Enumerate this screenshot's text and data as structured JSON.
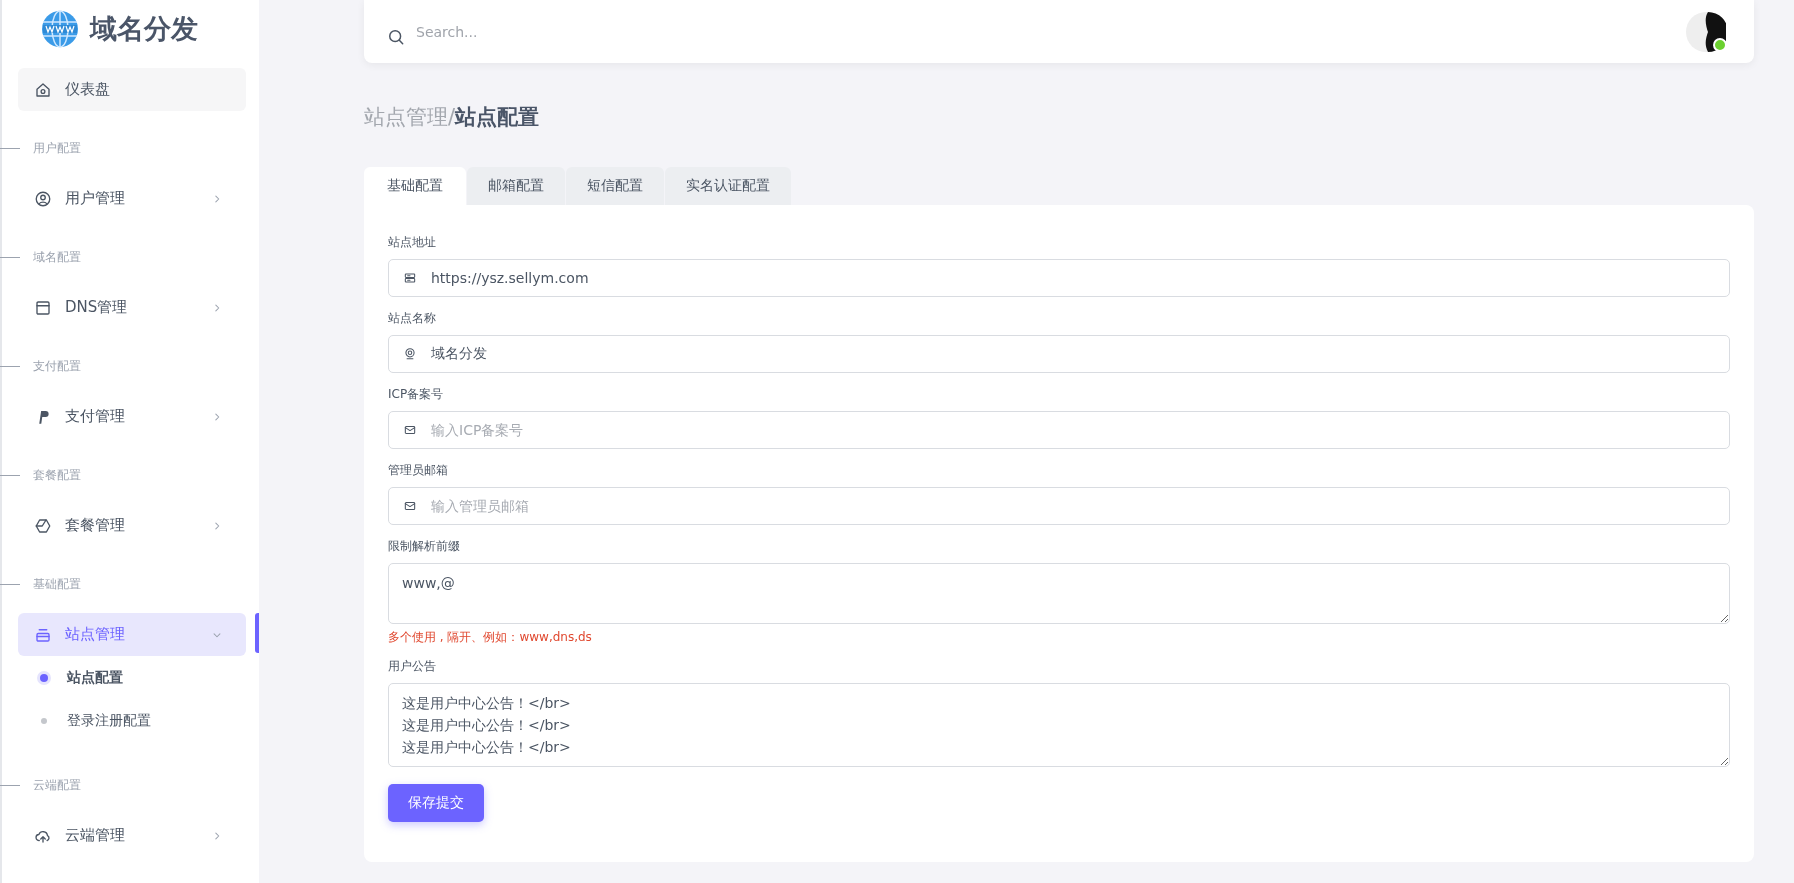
{
  "sidebar": {
    "logo_text": "域名分发",
    "items": [
      {
        "kind": "link",
        "label": "仪表盘",
        "selected": false
      },
      {
        "kind": "section",
        "label": "用户配置"
      },
      {
        "kind": "group",
        "label": "用户管理",
        "expanded": false,
        "selected": false
      },
      {
        "kind": "section",
        "label": "域名配置"
      },
      {
        "kind": "group",
        "label": "DNS管理",
        "expanded": false,
        "selected": false
      },
      {
        "kind": "section",
        "label": "支付配置"
      },
      {
        "kind": "group",
        "label": "支付管理",
        "expanded": false,
        "selected": false
      },
      {
        "kind": "section",
        "label": "套餐配置"
      },
      {
        "kind": "group",
        "label": "套餐管理",
        "expanded": false,
        "selected": false
      },
      {
        "kind": "section",
        "label": "基础配置"
      },
      {
        "kind": "group",
        "label": "站点管理",
        "expanded": true,
        "selected": true,
        "children": [
          {
            "label": "站点配置",
            "selected": true
          },
          {
            "label": "登录注册配置",
            "selected": false
          }
        ]
      },
      {
        "kind": "section",
        "label": "云端配置"
      },
      {
        "kind": "group",
        "label": "云端管理",
        "expanded": false,
        "selected": false
      }
    ]
  },
  "topbar": {
    "search": {
      "placeholder": "Search..."
    },
    "user": {
      "online": true
    }
  },
  "breadcrumb": {
    "parent": "站点管理/",
    "current": "站点配置"
  },
  "tabs": [
    {
      "label": "基础配置",
      "selected": true
    },
    {
      "label": "邮箱配置",
      "selected": false
    },
    {
      "label": "短信配置",
      "selected": false
    },
    {
      "label": "实名认证配置",
      "selected": false
    }
  ],
  "form": {
    "fields": [
      {
        "kind": "input",
        "label": "站点地址",
        "value": "https://ysz.sellym.com"
      },
      {
        "kind": "input",
        "label": "站点名称",
        "value": "域名分发"
      },
      {
        "kind": "input",
        "label": "ICP备案号",
        "placeholder": "输入ICP备案号"
      },
      {
        "kind": "input",
        "label": "管理员邮箱",
        "placeholder": "输入管理员邮箱"
      },
      {
        "kind": "textarea",
        "label": "限制解析前缀",
        "value": "www,@",
        "hint": "多个使用 , 隔开、例如：www,dns,ds"
      },
      {
        "kind": "textarea",
        "label": "用户公告",
        "value": "这是用户中心公告！</br>\n这是用户中心公告！</br>\n这是用户中心公告！</br>"
      }
    ],
    "submit": "保存提交"
  }
}
